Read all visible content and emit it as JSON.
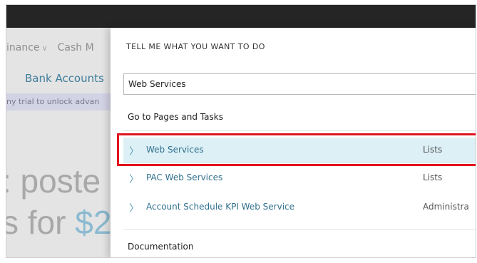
{
  "background": {
    "nav_finance": "inance",
    "nav_cash": "Cash M",
    "bank_accounts": "Bank Accounts",
    "trial_text": "ny trial to unlock advan",
    "big_line1": ": poste",
    "big_line2_prefix": "s for ",
    "big_line2_money": "$2"
  },
  "panel": {
    "title": "TELL ME WHAT YOU WANT TO DO",
    "search_value": "Web Services",
    "section_pages": "Go to Pages and Tasks",
    "results": [
      {
        "name": "Web Services",
        "category": "Lists"
      },
      {
        "name": "PAC Web Services",
        "category": "Lists"
      },
      {
        "name": "Account Schedule KPI Web Service",
        "category": "Administra"
      }
    ],
    "section_docs": "Documentation"
  }
}
